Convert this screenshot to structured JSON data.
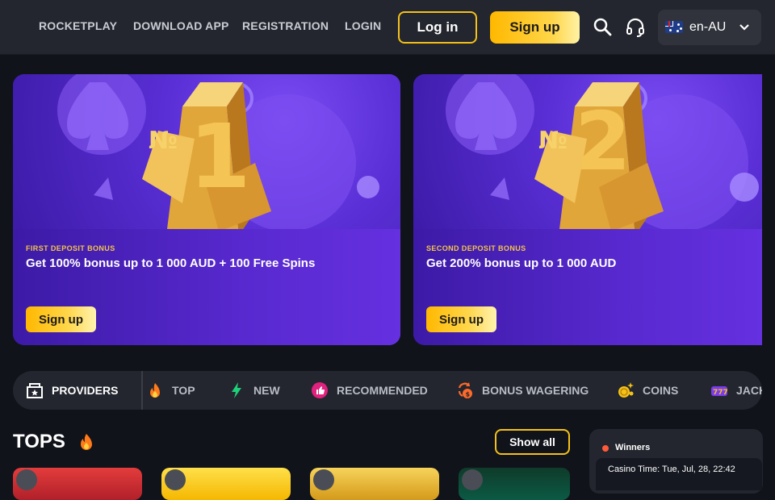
{
  "nav": {
    "links": [
      "ROCKETPLAY",
      "DOWNLOAD APP",
      "REGISTRATION",
      "LOGIN"
    ],
    "login_label": "Log in",
    "signup_label": "Sign up",
    "language": "en-AU"
  },
  "banners": [
    {
      "eyebrow": "FIRST DEPOSIT BONUS",
      "title": "Get 100% bonus up to 1 000 AUD + 100 Free Spins",
      "button": "Sign up",
      "number": "1",
      "badge": "№"
    },
    {
      "eyebrow": "SECOND DEPOSIT BONUS",
      "title": "Get 200% bonus up to 1 000 AUD",
      "button": "Sign up",
      "number": "2",
      "badge": "№"
    }
  ],
  "categories": [
    "PROVIDERS",
    "TOP",
    "NEW",
    "RECOMMENDED",
    "BONUS WAGERING",
    "COINS",
    "JACKPOT"
  ],
  "tops": {
    "title": "TOPS",
    "show_all": "Show all"
  },
  "winners": {
    "label": "Winners",
    "casino_time": "Casino Time: Tue, Jul, 28, 22:42"
  },
  "colors": {
    "accent": "#f5c118",
    "bg": "#10131a",
    "bar": "#23262e",
    "purple": "#5b2ad1"
  }
}
